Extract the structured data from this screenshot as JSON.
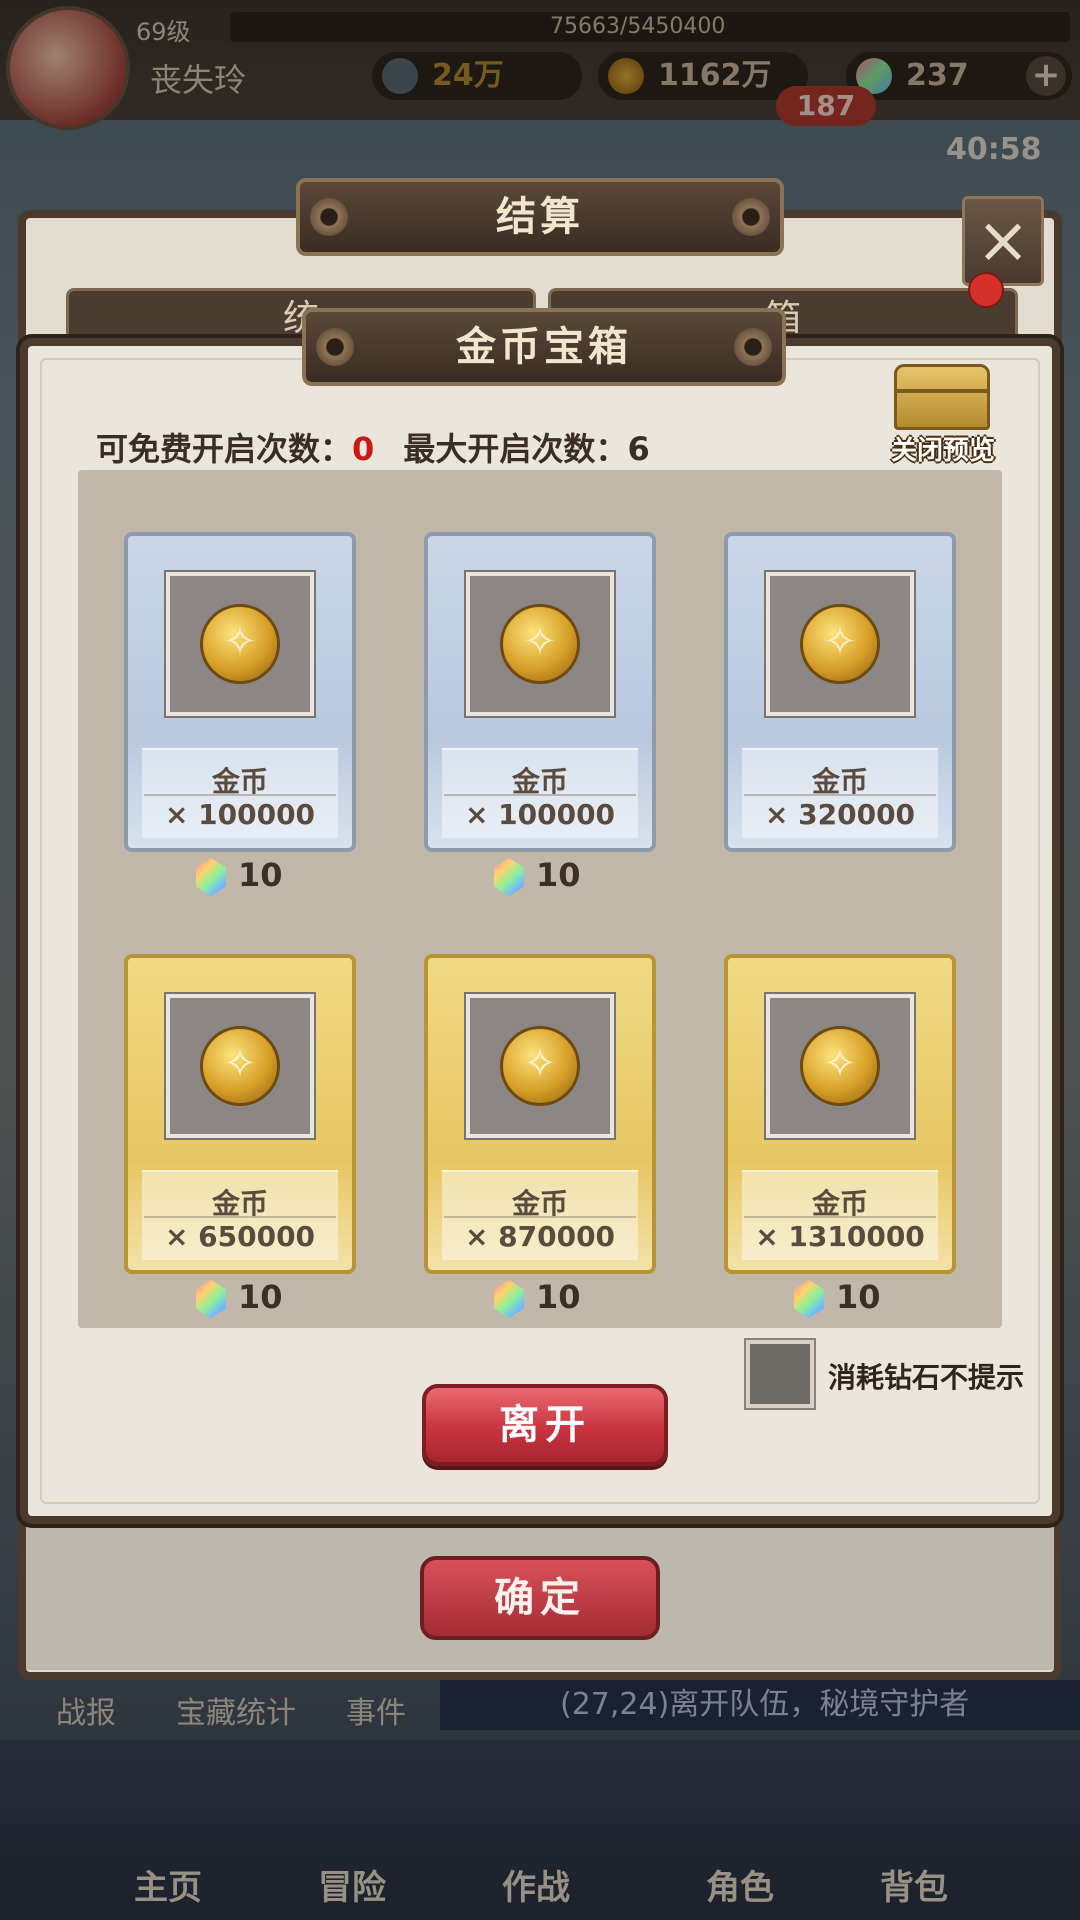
{
  "hud": {
    "level": "69级",
    "exp": "75663/5450400",
    "player_name": "丧失玲",
    "power": "24万",
    "gold": "1162万",
    "diamonds": "237",
    "notification_count": "187",
    "timer": "40:58"
  },
  "settlement": {
    "title": "结算",
    "tab_left": "统",
    "tab_right": "箱",
    "confirm_label": "确定"
  },
  "chest_dialog": {
    "title": "金币宝箱",
    "free_opens_label": "可免费开启次数：",
    "free_opens_value": "0",
    "max_opens_label": "最大开启次数：",
    "max_opens_value": "6",
    "preview_label": "关闭预览",
    "rewards": [
      {
        "name": "金币",
        "qty": "× 100000",
        "tier": "silver",
        "price": "10"
      },
      {
        "name": "金币",
        "qty": "× 100000",
        "tier": "silver",
        "price": "10"
      },
      {
        "name": "金币",
        "qty": "× 320000",
        "tier": "silver",
        "price": ""
      },
      {
        "name": "金币",
        "qty": "× 650000",
        "tier": "gold",
        "price": "10"
      },
      {
        "name": "金币",
        "qty": "× 870000",
        "tier": "gold",
        "price": "10"
      },
      {
        "name": "金币",
        "qty": "× 1310000",
        "tier": "gold",
        "price": "10"
      }
    ],
    "checkbox_label": "消耗钻石不提示",
    "leave_label": "离开"
  },
  "bottom": {
    "tabs": [
      "战报",
      "宝藏统计",
      "事件"
    ],
    "event_text": "(27,24)离开队伍，秘境守护者",
    "nav": [
      "主页",
      "冒险",
      "作战",
      "角色",
      "背包"
    ]
  },
  "colors": {
    "accent_red": "#c61a12",
    "button_red": "#c8343f",
    "frame_brown": "#4a3b2e",
    "silver_card": "#c9d6e8",
    "gold_card": "#f0d984"
  }
}
